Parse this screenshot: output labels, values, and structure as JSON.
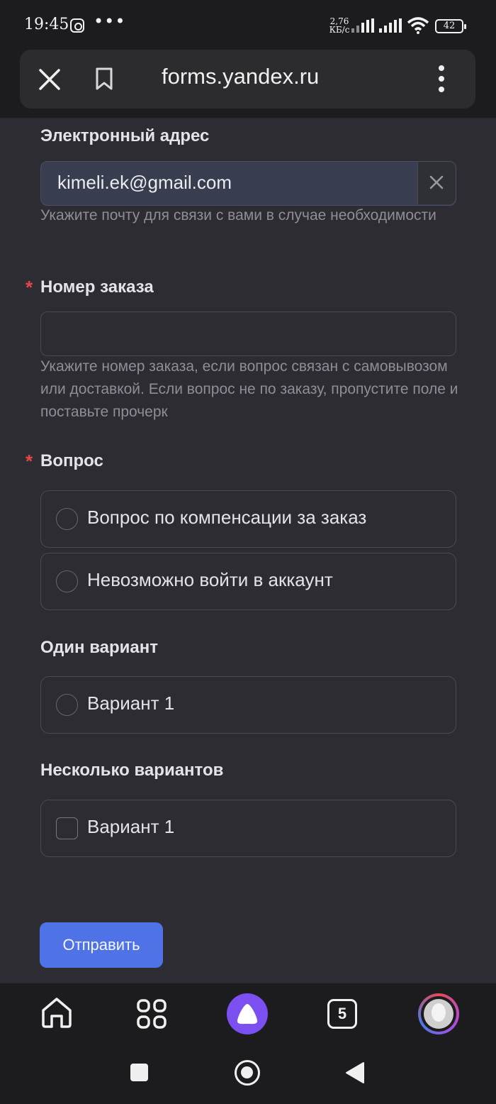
{
  "status_bar": {
    "time": "19:45",
    "more": "•••",
    "net_speed_value": "2,76",
    "net_speed_unit": "КБ/с",
    "battery": "42"
  },
  "browser": {
    "url": "forms.yandex.ru",
    "close_icon": "close-icon",
    "bookmark_icon": "bookmark-icon",
    "menu_icon": "more-vertical-icon"
  },
  "form": {
    "email": {
      "label": "Электронный адрес",
      "value": "kimeli.ek@gmail.com",
      "hint": "Укажите почту для связи с вами в случае необходимости"
    },
    "order": {
      "required_mark": "*",
      "label": "Номер заказа",
      "value": "",
      "hint": "Укажите номер заказа, если вопрос связан с самовывозом или доставкой. Если вопрос не по заказу, пропустите поле и поставьте прочерк"
    },
    "question": {
      "required_mark": "*",
      "label": "Вопрос",
      "options": [
        {
          "label": "Вопрос по компенсации за заказ",
          "selected": false
        },
        {
          "label": "Невозможно войти в аккаунт",
          "selected": false
        }
      ]
    },
    "single_choice": {
      "label": "Один вариант",
      "options": [
        {
          "label": "Вариант 1",
          "selected": false
        }
      ]
    },
    "multi_choice": {
      "label": "Несколько вариантов",
      "options": [
        {
          "label": "Вариант 1",
          "checked": false
        }
      ]
    },
    "submit_label": "Отправить"
  },
  "bottom_nav": {
    "tabs_count": "5",
    "items": [
      "home-icon",
      "apps-grid-icon",
      "alice-icon",
      "tabs-counter-icon",
      "profile-avatar"
    ]
  },
  "system_nav": [
    "recents-icon",
    "home-circle-icon",
    "back-icon"
  ],
  "colors": {
    "background": "#2c2c32",
    "accent": "#4f73e6",
    "required": "#e2484a",
    "alice": "#7b4ff0"
  }
}
